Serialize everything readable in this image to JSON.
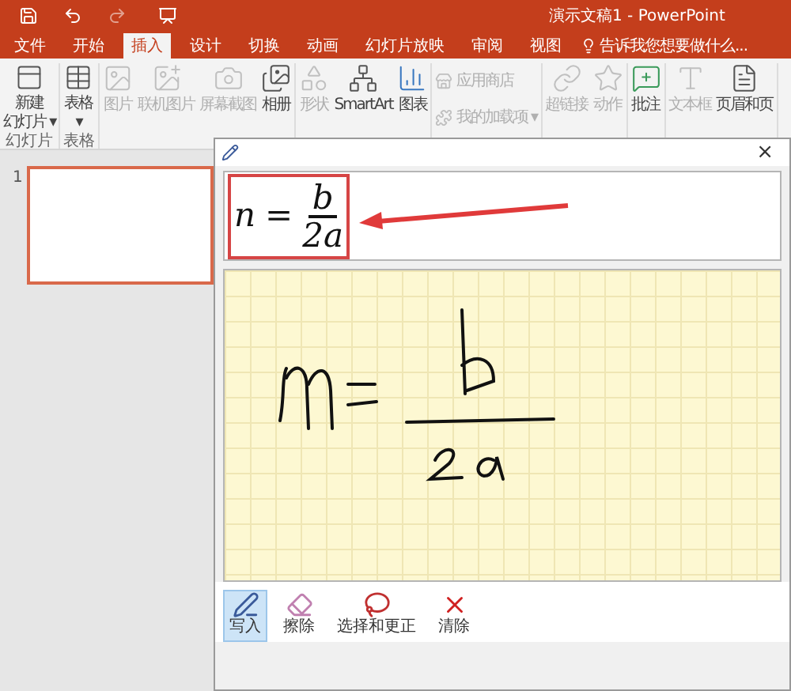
{
  "window": {
    "title": "演示文稿1 - PowerPoint"
  },
  "tabs": [
    {
      "label": "文件",
      "selected": false
    },
    {
      "label": "开始",
      "selected": false
    },
    {
      "label": "插入",
      "selected": true
    },
    {
      "label": "设计",
      "selected": false
    },
    {
      "label": "切换",
      "selected": false
    },
    {
      "label": "动画",
      "selected": false
    },
    {
      "label": "幻灯片放映",
      "selected": false
    },
    {
      "label": "审阅",
      "selected": false
    },
    {
      "label": "视图",
      "selected": false
    }
  ],
  "tell_me": {
    "placeholder": "告诉我您想要做什么..."
  },
  "ribbon": [
    {
      "label": "幻灯片",
      "items": [
        {
          "kind": "big",
          "lines": [
            "新建",
            "幻灯片 ▾"
          ],
          "disabled": false
        }
      ]
    },
    {
      "label": "表格",
      "items": [
        {
          "kind": "big",
          "lines": [
            "表格",
            "▾"
          ],
          "disabled": false
        }
      ]
    },
    {
      "items": [
        {
          "kind": "big",
          "lines": [
            "图片"
          ],
          "disabled": true
        },
        {
          "kind": "big",
          "lines": [
            "联机图片"
          ],
          "disabled": true
        },
        {
          "kind": "big",
          "lines": [
            "屏幕截图"
          ],
          "disabled": true
        },
        {
          "kind": "big",
          "lines": [
            "相册"
          ],
          "disabled": false
        }
      ]
    },
    {
      "items": [
        {
          "kind": "big",
          "lines": [
            "形状"
          ],
          "disabled": true
        },
        {
          "kind": "big",
          "lines": [
            "SmartArt"
          ],
          "disabled": false
        },
        {
          "kind": "big",
          "lines": [
            "图表"
          ],
          "disabled": false
        }
      ]
    },
    {
      "items": [
        {
          "kind": "small",
          "lines": [
            "应用商店"
          ],
          "disabled": true
        },
        {
          "kind": "small",
          "lines": [
            "我的加载项 ▾"
          ],
          "disabled": true
        }
      ]
    },
    {
      "items": [
        {
          "kind": "big",
          "lines": [
            "超链接"
          ],
          "disabled": true
        },
        {
          "kind": "big",
          "lines": [
            "动作"
          ],
          "disabled": true
        }
      ]
    },
    {
      "items": [
        {
          "kind": "big",
          "lines": [
            "批注"
          ],
          "disabled": false
        }
      ]
    },
    {
      "items": [
        {
          "kind": "big",
          "lines": [
            "文本框"
          ],
          "disabled": true
        },
        {
          "kind": "big",
          "lines": [
            "页眉和页"
          ],
          "disabled": false
        }
      ]
    }
  ],
  "slides": [
    {
      "number": "1",
      "selected": true
    }
  ],
  "math_panel": {
    "close": "×",
    "preview": {
      "lhs": "n",
      "operator": "=",
      "numerator": "b",
      "denominator": "2a"
    },
    "tools": [
      {
        "label": "写入",
        "selected": true
      },
      {
        "label": "擦除",
        "selected": false
      },
      {
        "label": "选择和更正",
        "selected": false
      },
      {
        "label": "清除",
        "selected": false
      }
    ]
  }
}
